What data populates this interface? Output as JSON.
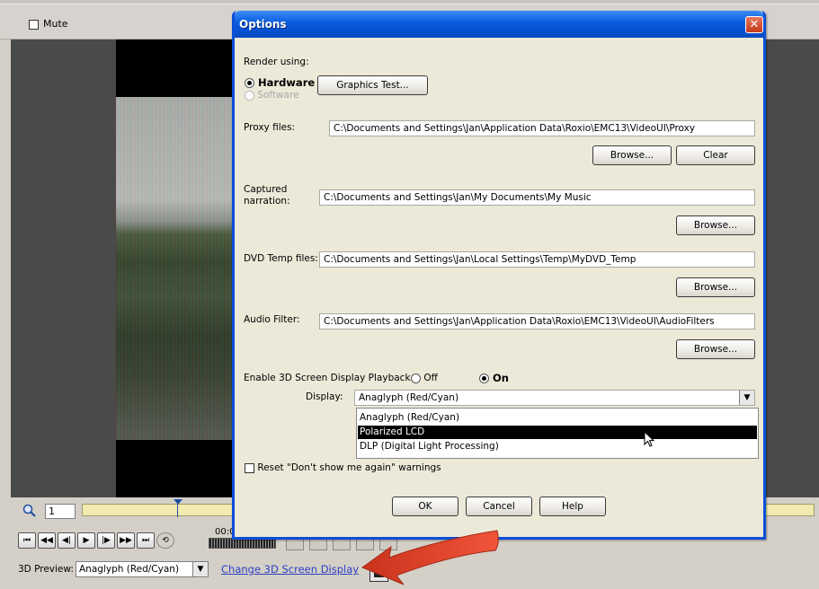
{
  "background_app": {
    "mute_label": "Mute",
    "zoom_value": "1",
    "timecode": "00:0",
    "preview_label": "3D Preview:",
    "preview_select_value": "Anaglyph (Red/Cyan)",
    "change_link": "Change 3D Screen Display",
    "transport_buttons": [
      {
        "name": "go-to-start",
        "glyph": "⏮"
      },
      {
        "name": "rewind",
        "glyph": "◀◀"
      },
      {
        "name": "step-back",
        "glyph": "◀|"
      },
      {
        "name": "play",
        "glyph": "▶"
      },
      {
        "name": "step-forward",
        "glyph": "|▶"
      },
      {
        "name": "fast-forward",
        "glyph": "▶▶"
      },
      {
        "name": "go-to-end",
        "glyph": "⏭"
      },
      {
        "name": "loop",
        "glyph": "⟲"
      }
    ]
  },
  "dialog": {
    "title": "Options",
    "close_glyph": "✕",
    "render_label": "Render using:",
    "render_hardware": "Hardware",
    "render_software": "Software",
    "graphics_test": "Graphics Test...",
    "proxy_label": "Proxy files:",
    "proxy_path": "C:\\Documents and Settings\\Jan\\Application Data\\Roxio\\EMC13\\VideoUI\\Proxy",
    "proxy_browse": "Browse...",
    "proxy_clear": "Clear",
    "narration_label_1": "Captured",
    "narration_label_2": "narration:",
    "narration_path": "C:\\Documents and Settings\\Jan\\My Documents\\My Music",
    "narration_browse": "Browse...",
    "dvd_label": "DVD Temp files:",
    "dvd_path": "C:\\Documents and Settings\\Jan\\Local Settings\\Temp\\MyDVD_Temp",
    "dvd_browse": "Browse...",
    "audio_label": "Audio Filter:",
    "audio_path": "C:\\Documents and Settings\\Jan\\Application Data\\Roxio\\EMC13\\VideoUI\\AudioFilters",
    "audio_browse": "Browse...",
    "enable3d_label": "Enable 3D Screen Display Playback:",
    "enable3d_off": "Off",
    "enable3d_on": "On",
    "display_label": "Display:",
    "display_value": "Anaglyph (Red/Cyan)",
    "display_options": [
      "Anaglyph (Red/Cyan)",
      "Polarized LCD",
      "DLP (Digital Light Processing)"
    ],
    "display_highlighted": "Polarized LCD",
    "reset_label": "Reset \"Don't show me again\" warnings",
    "ok": "OK",
    "cancel": "Cancel",
    "help": "Help"
  },
  "colors": {
    "title_bar": "#0a5bdc",
    "annotation_arrow": "#e8432a",
    "link": "#2a3fc2"
  }
}
